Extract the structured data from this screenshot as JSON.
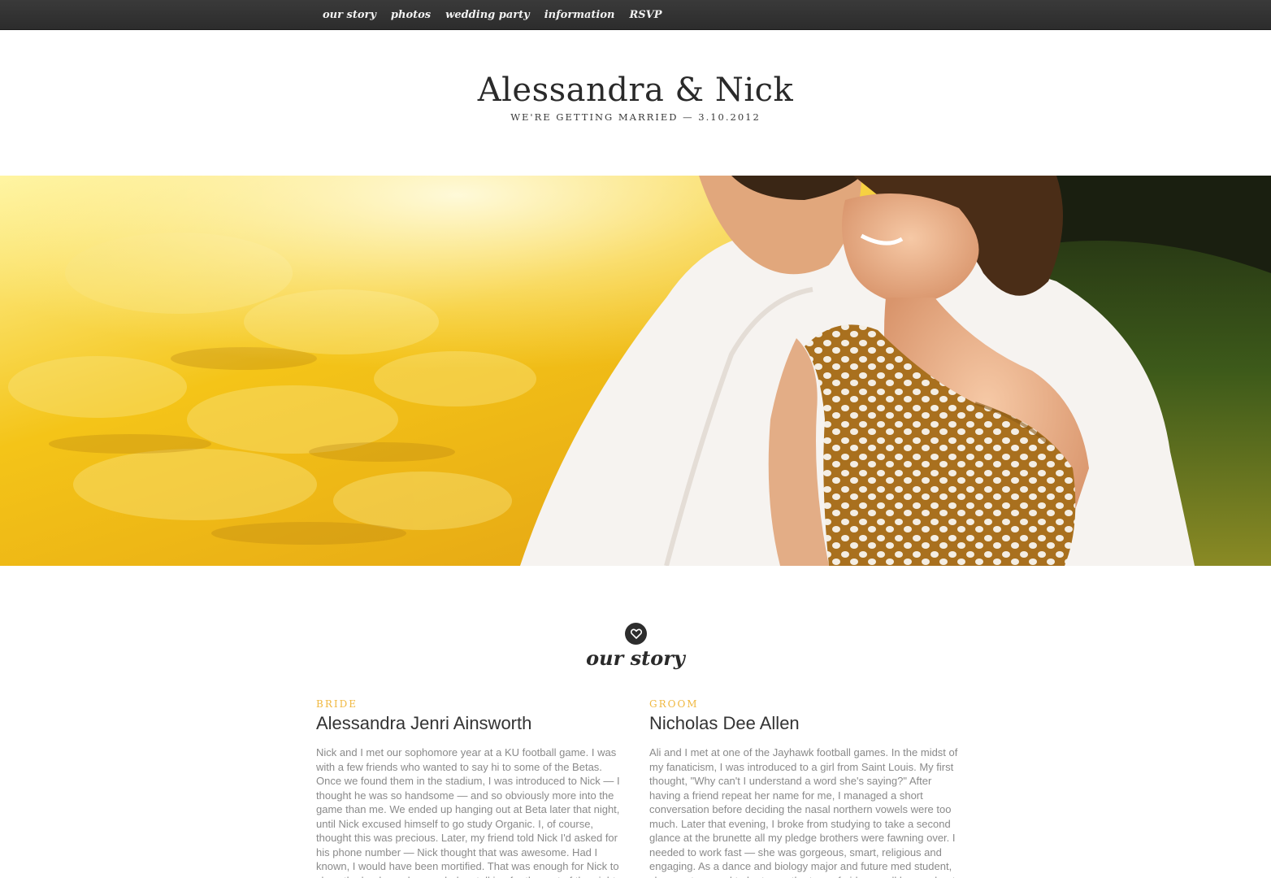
{
  "nav": {
    "items": [
      "our story",
      "photos",
      "wedding party",
      "information",
      "RSVP"
    ]
  },
  "header": {
    "title": "Alessandra & Nick",
    "tagline": "WE'RE GETTING MARRIED — 3.10.2012"
  },
  "section": {
    "icon": "heart-icon",
    "title": "our story"
  },
  "bride": {
    "role": "BRIDE",
    "name": "Alessandra Jenri Ainsworth",
    "bio": "Nick and I met our sophomore year at a KU football game. I was with a few friends who wanted to say hi to some of the Betas. Once we found them in the stadium, I was introduced to Nick — I thought he was so handsome — and so obviously more into the game than me. We ended up hanging out at Beta later that night, until Nick excused himself to go study Organic. I, of course, thought this was precious. Later, my friend told Nick I'd asked for his phone number — Nick thought that was awesome. Had I known, I would have been mortified. That was enough for Nick to close the books and we ended up talking for the rest of the night. He walked me home"
  },
  "groom": {
    "role": "GROOM",
    "name": "Nicholas Dee Allen",
    "bio": "Ali and I met at one of the Jayhawk football games. In the midst of my fanaticism, I was introduced to a girl from Saint Louis. My first thought, \"Why can't I understand a word she's saying?\" After having a friend repeat her name for me, I managed a short conversation before deciding the nasal northern vowels were too much. Later that evening, I broke from studying to take a second glance at the brunette all my pledge brothers were fawning over. I needed to work fast — she was gorgeous, smart, religious and engaging. As a dance and biology major and future med student, she was too good to be true... the type of girl you call home about"
  },
  "colors": {
    "nav_bg": "#2f2f2f",
    "accent": "#f0b840",
    "text_dark": "#2a2a2a",
    "text_muted": "#8a8a8a"
  }
}
